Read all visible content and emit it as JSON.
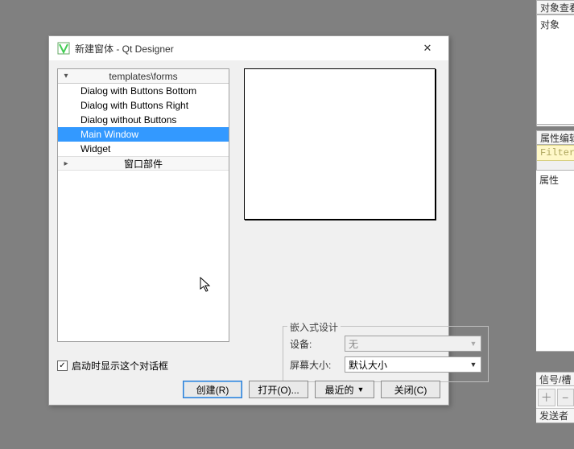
{
  "dialog": {
    "title": "新建窗体 - Qt Designer"
  },
  "tree": {
    "header": "templates\\forms",
    "items": [
      {
        "label": "Dialog with Buttons Bottom",
        "selected": false
      },
      {
        "label": "Dialog with Buttons Right",
        "selected": false
      },
      {
        "label": "Dialog without Buttons",
        "selected": false
      },
      {
        "label": "Main Window",
        "selected": true
      },
      {
        "label": "Widget",
        "selected": false
      }
    ],
    "subheader": "窗口部件"
  },
  "embed": {
    "group_label": "嵌入式设计",
    "device_label": "设备:",
    "device_value": "无",
    "screen_label": "屏幕大小:",
    "screen_value": "默认大小"
  },
  "checkbox": {
    "label": "启动时显示这个对话框",
    "checked": true
  },
  "buttons": {
    "create": "创建(R)",
    "open": "打开(O)...",
    "recent": "最近的",
    "close": "关闭(C)"
  },
  "right": {
    "object_inspector_title": "对象查看",
    "object_col": "对象",
    "property_editor_title": "属性编辑",
    "filter_placeholder": "Filter",
    "property_col": "属性",
    "signal_slot_title": "信号/槽",
    "sender_col": "发送者"
  }
}
